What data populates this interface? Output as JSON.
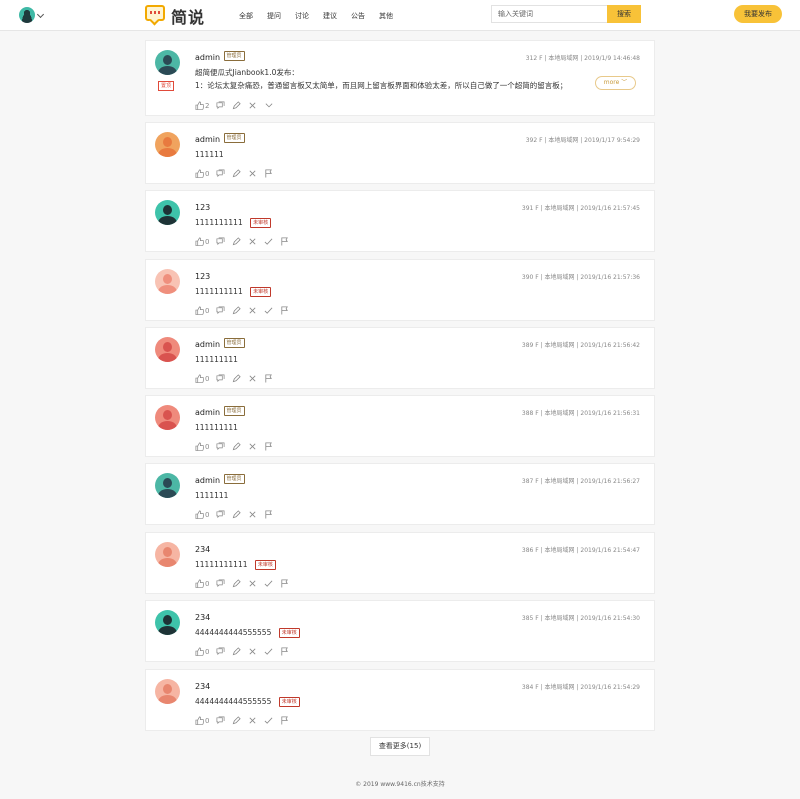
{
  "header": {
    "logo_text": "简说",
    "nav": [
      "全部",
      "提问",
      "讨论",
      "建议",
      "公告",
      "其他"
    ],
    "search_placeholder": "输入关键词",
    "search_button": "搜索",
    "publish_button": "我要发布"
  },
  "labels": {
    "more": "more",
    "pinned": "置顶"
  },
  "colors": {
    "accent": "#f8c238",
    "admin_tag": "#8a6d3b",
    "pending_tag": "#c0392b"
  },
  "posts": [
    {
      "author": "admin",
      "tag": "管理员",
      "tag_type": "admin",
      "meta": "312 F   | 本地局域网 | 2019/1/9 14:46:48",
      "lines": [
        "超简便瓜式Jianbook1.0发布：",
        "1：论坛太复杂痛恐，普通留言板又太简单，而且网上留言板界面和体验太差，所以自己做了一个超简的留言板；"
      ],
      "likes": "2",
      "pinned": true,
      "has_more": true,
      "avatar": "teal",
      "actions": [
        "like",
        "comment",
        "edit",
        "delete",
        "expand"
      ]
    },
    {
      "author": "admin",
      "tag": "管理员",
      "tag_type": "admin",
      "meta": "392 F   | 本地局域网 | 2019/1/17 9:54:29",
      "lines": [
        "111111"
      ],
      "likes": "0",
      "avatar": "orange",
      "actions": [
        "like",
        "comment",
        "edit",
        "delete",
        "flag"
      ]
    },
    {
      "author": "123",
      "tag": "未审核",
      "tag_type": "pending",
      "meta": "391 F   | 本地局域网 | 2019/1/16 21:57:45",
      "lines": [
        "1111111111"
      ],
      "likes": "0",
      "avatar": "teal-dark",
      "actions": [
        "like",
        "comment",
        "edit",
        "delete",
        "approve",
        "flag"
      ]
    },
    {
      "author": "123",
      "tag": "未审核",
      "tag_type": "pending",
      "meta": "390 F   | 本地局域网 | 2019/1/16 21:57:36",
      "lines": [
        "1111111111"
      ],
      "likes": "0",
      "avatar": "salmon-light",
      "actions": [
        "like",
        "comment",
        "edit",
        "delete",
        "approve",
        "flag"
      ]
    },
    {
      "author": "admin",
      "tag": "管理员",
      "tag_type": "admin",
      "meta": "389 F   | 本地局域网 | 2019/1/16 21:56:42",
      "lines": [
        "111111111"
      ],
      "likes": "0",
      "avatar": "red",
      "actions": [
        "like",
        "comment",
        "edit",
        "delete",
        "flag"
      ]
    },
    {
      "author": "admin",
      "tag": "管理员",
      "tag_type": "admin",
      "meta": "388 F   | 本地局域网 | 2019/1/16 21:56:31",
      "lines": [
        "111111111"
      ],
      "likes": "0",
      "avatar": "red",
      "actions": [
        "like",
        "comment",
        "edit",
        "delete",
        "flag"
      ]
    },
    {
      "author": "admin",
      "tag": "管理员",
      "tag_type": "admin",
      "meta": "387 F   | 本地局域网 | 2019/1/16 21:56:27",
      "lines": [
        "1111111"
      ],
      "likes": "0",
      "avatar": "teal",
      "actions": [
        "like",
        "comment",
        "edit",
        "delete",
        "flag"
      ]
    },
    {
      "author": "234",
      "tag": "未审核",
      "tag_type": "pending",
      "meta": "386 F   | 本地局域网 | 2019/1/16 21:54:47",
      "lines": [
        "11111111111"
      ],
      "likes": "0",
      "avatar": "salmon",
      "actions": [
        "like",
        "comment",
        "edit",
        "delete",
        "approve",
        "flag"
      ]
    },
    {
      "author": "234",
      "tag": "未审核",
      "tag_type": "pending",
      "meta": "385 F   | 本地局域网 | 2019/1/16 21:54:30",
      "lines": [
        "4444444444555555"
      ],
      "likes": "0",
      "avatar": "teal-dark",
      "actions": [
        "like",
        "comment",
        "edit",
        "delete",
        "approve",
        "flag"
      ]
    },
    {
      "author": "234",
      "tag": "未审核",
      "tag_type": "pending",
      "meta": "384 F   | 本地局域网 | 2019/1/16 21:54:29",
      "lines": [
        "4444444444555555"
      ],
      "likes": "0",
      "avatar": "salmon",
      "actions": [
        "like",
        "comment",
        "edit",
        "delete",
        "approve",
        "flag"
      ]
    }
  ],
  "load_more": "查看更多(15)",
  "footer": "© 2019 www.9416.cn技术支持"
}
